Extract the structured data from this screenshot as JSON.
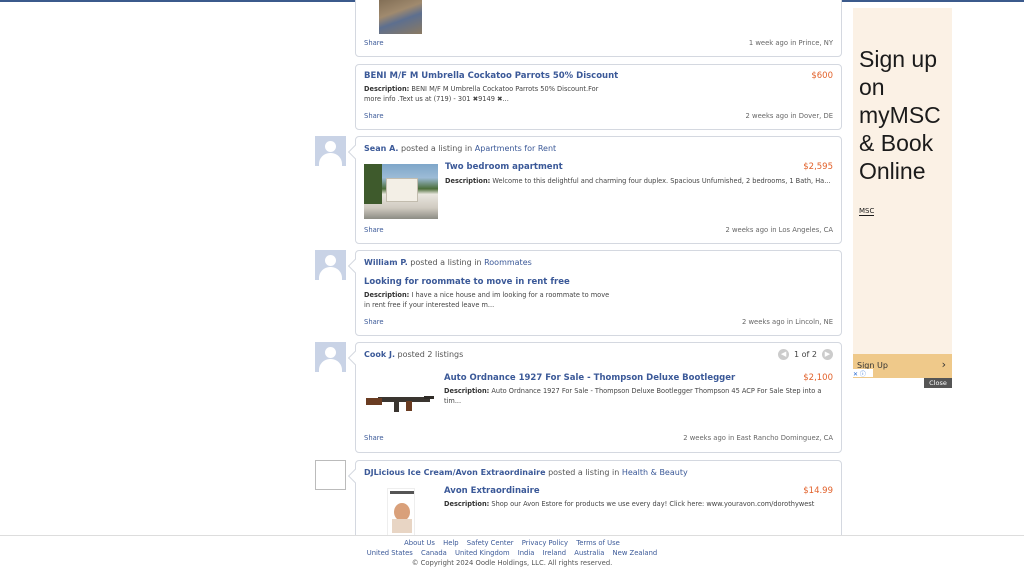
{
  "share_label": "Share",
  "description_label": "Description:",
  "cards": [
    {
      "meta": "1 week ago in Prince, NY"
    },
    {
      "title": "BENI M/F M Umbrella Cockatoo Parrots 50% Discount",
      "price": "$600",
      "desc_line1": "BENI M/F M Umbrella Cockatoo Parrots 50% Discount.For",
      "desc_line2": "more info .Text us at (719) - 301 ✖9149 ✖...",
      "meta": "2 weeks ago in Dover, DE"
    },
    {
      "poster": "Sean A.",
      "posted_text": "posted a listing in",
      "category": "Apartments for Rent",
      "title": "Two bedroom apartment",
      "price": "$2,595",
      "desc_line1": "Welcome to this delightful and charming four duplex. Spacious Unfurnished, 2 bedrooms, 1 Bath, Ha...",
      "meta": "2 weeks ago in Los Angeles, CA"
    },
    {
      "poster": "William P.",
      "posted_text": "posted a listing in",
      "category": "Roommates",
      "title": "Looking for roommate to move in rent free",
      "desc_line1": "I have a nice house and im looking for a roommate to move",
      "desc_line2": "in rent free if your interested leave m...",
      "meta": "2 weeks ago in Lincoln, NE"
    },
    {
      "poster": "Cook J.",
      "posted_text": "posted 2 listings",
      "pager": "1 of 2",
      "title": "Auto Ordnance 1927 For Sale - Thompson Deluxe Bootlegger",
      "price": "$2,100",
      "desc_line1": "Auto Ordnance 1927 For Sale - Thompson Deluxe Bootlegger Thompson 45 ACP For Sale Step into a",
      "desc_line2": "tim...",
      "meta": "2 weeks ago in East Rancho Dominguez, CA"
    },
    {
      "poster": "DJLicious Ice Cream/Avon Extraordinaire",
      "posted_text": "posted a listing in",
      "category": "Health & Beauty",
      "title": "Avon Extraordinaire",
      "price": "$14.99",
      "desc_line1": "Shop our Avon Estore for products we use every day! Click here: www.youravon.com/dorothywest"
    }
  ],
  "ad": {
    "headline_1": "Sign up",
    "headline_2": "on",
    "headline_3": "myMSC",
    "headline_4": "& Book",
    "headline_5": "Online",
    "brand": "MSC",
    "cta": "Sign Up",
    "close": "Close"
  },
  "footer": {
    "links": [
      "About Us",
      "Help",
      "Safety Center",
      "Privacy Policy",
      "Terms of Use"
    ],
    "countries": [
      "United States",
      "Canada",
      "United Kingdom",
      "India",
      "Ireland",
      "Australia",
      "New Zealand"
    ],
    "copyright": "© Copyright 2024 Oodle Holdings, LLC. All rights reserved."
  }
}
